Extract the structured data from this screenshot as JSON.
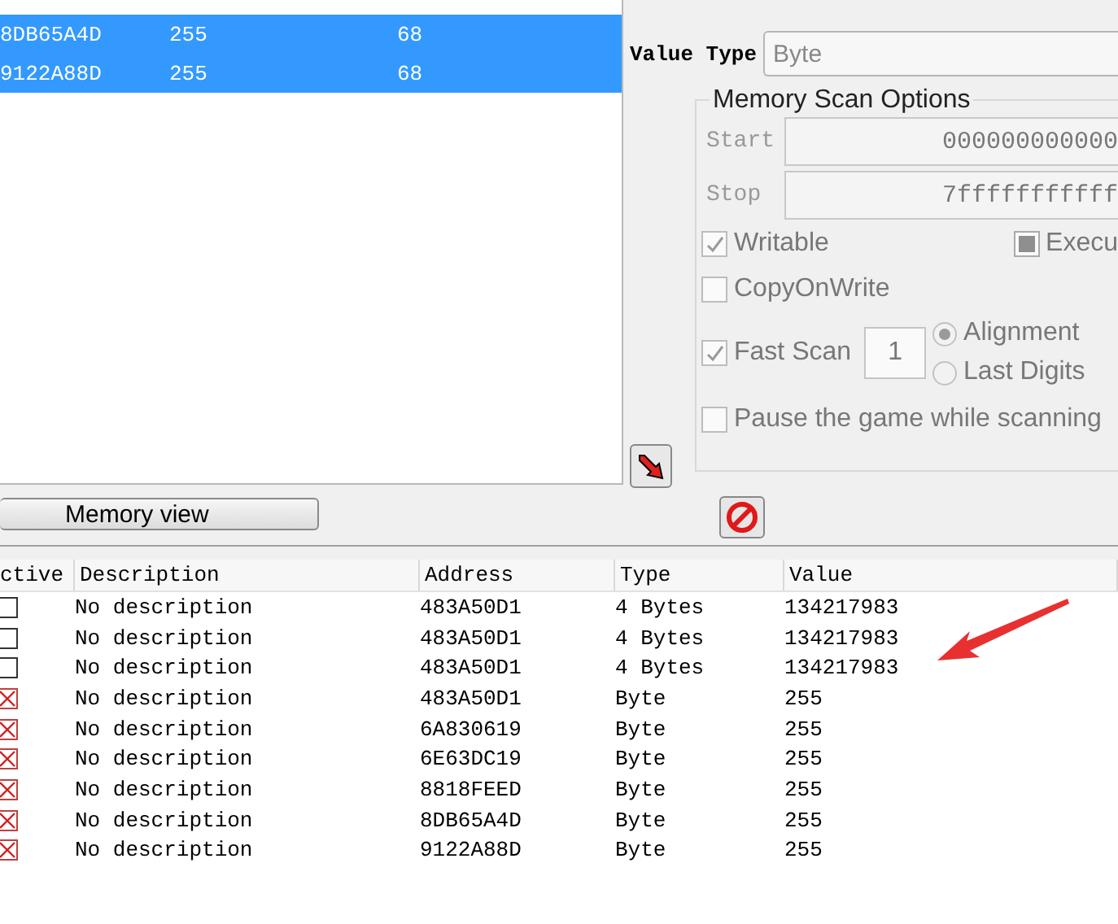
{
  "scan_results": {
    "rows": [
      {
        "address": "8DB65A4D",
        "value": "255",
        "previous": "68",
        "selected": true
      },
      {
        "address": "9122A88D",
        "value": "255",
        "previous": "68",
        "selected": true
      }
    ]
  },
  "memory_view_button": "Memory view",
  "value_type": {
    "label": "Value Type",
    "value": "Byte"
  },
  "memory_scan_options": {
    "title": "Memory Scan Options",
    "start": {
      "label": "Start",
      "value": "000000000000"
    },
    "stop": {
      "label": "Stop",
      "value": "7fffffffffff"
    },
    "writable": {
      "label": "Writable",
      "checked": true
    },
    "executable": {
      "label": "Execu",
      "indeterminate": true
    },
    "copy_on_write": {
      "label": "CopyOnWrite",
      "checked": false
    },
    "fast_scan": {
      "label": "Fast Scan",
      "checked": true,
      "value": "1"
    },
    "alignment_options": [
      {
        "label": "Alignment",
        "selected": true
      },
      {
        "label": "Last Digits",
        "selected": false
      }
    ],
    "pause_game": {
      "label": "Pause the game while scanning",
      "checked": false
    }
  },
  "address_list": {
    "columns": [
      "ctive",
      "Description",
      "Address",
      "Type",
      "Value"
    ],
    "rows": [
      {
        "active": false,
        "description": "No description",
        "address": "483A50D1",
        "type": "4 Bytes",
        "value": "134217983"
      },
      {
        "active": false,
        "description": "No description",
        "address": "483A50D1",
        "type": "4 Bytes",
        "value": "134217983"
      },
      {
        "active": false,
        "description": "No description",
        "address": "483A50D1",
        "type": "4 Bytes",
        "value": "134217983"
      },
      {
        "active": true,
        "description": "No description",
        "address": "483A50D1",
        "type": "Byte",
        "value": "255"
      },
      {
        "active": true,
        "description": "No description",
        "address": "6A830619",
        "type": "Byte",
        "value": "255"
      },
      {
        "active": true,
        "description": "No description",
        "address": "6E63DC19",
        "type": "Byte",
        "value": "255"
      },
      {
        "active": true,
        "description": "No description",
        "address": "8818FEED",
        "type": "Byte",
        "value": "255"
      },
      {
        "active": true,
        "description": "No description",
        "address": "8DB65A4D",
        "type": "Byte",
        "value": "255"
      },
      {
        "active": true,
        "description": "No description",
        "address": "9122A88D",
        "type": "Byte",
        "value": "255"
      }
    ]
  }
}
